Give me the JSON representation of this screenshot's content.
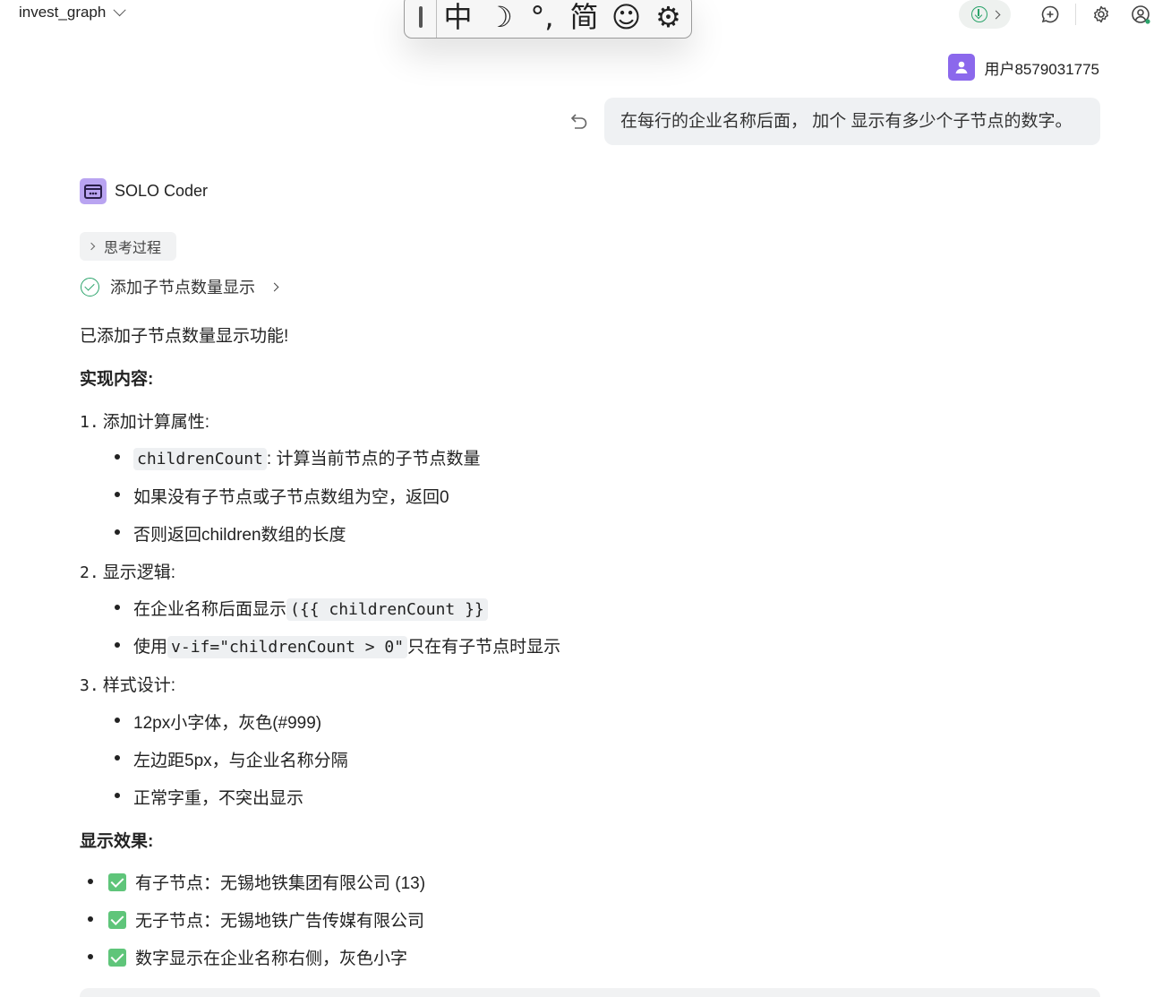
{
  "header": {
    "project_name": "invest_graph",
    "icons": [
      "download-status-icon",
      "new-chat-icon",
      "settings-icon",
      "account-icon"
    ]
  },
  "ime_toolbar": {
    "items": [
      "中",
      "☽",
      "°,",
      "简",
      "☺",
      "⚙"
    ]
  },
  "user": {
    "name": "用户8579031775",
    "message": "在每行的企业名称后面， 加个 显示有多少个子节点的数字。"
  },
  "assistant": {
    "name": "SOLO Coder",
    "thinking_label": "思考过程",
    "task_label": "添加子节点数量显示",
    "intro": "已添加子节点数量显示功能!",
    "impl_heading": "实现内容:",
    "sections": [
      {
        "num": "1.",
        "title": "添加计算属性:",
        "bullets": [
          {
            "code": "childrenCount",
            "text": ": 计算当前节点的子节点数量"
          },
          {
            "text": "如果没有子节点或子节点数组为空，返回0"
          },
          {
            "text": "否则返回children数组的长度"
          }
        ]
      },
      {
        "num": "2.",
        "title": "显示逻辑:",
        "bullets": [
          {
            "text": "在企业名称后面显示",
            "code": "({{ childrenCount }}"
          },
          {
            "pre": "使用",
            "code": "v-if=\"childrenCount > 0\"",
            "text": "只在有子节点时显示"
          }
        ]
      },
      {
        "num": "3.",
        "title": "样式设计:",
        "bullets": [
          {
            "text": "12px小字体，灰色(#999)"
          },
          {
            "text": "左边距5px，与企业名称分隔"
          },
          {
            "text": "正常字重，不突出显示"
          }
        ]
      }
    ],
    "effect_heading": "显示效果:",
    "effects": [
      "有子节点：无锡地铁集团有限公司 (13)",
      "无子节点：无锡地铁广告传媒有限公司",
      "数字显示在企业名称右侧，灰色小字"
    ]
  },
  "colors": {
    "accent_green": "#2aa36a",
    "user_avatar": "#8b68ec",
    "bot_avatar": "#b9a4f1",
    "bubble_bg": "#eff1f3"
  }
}
